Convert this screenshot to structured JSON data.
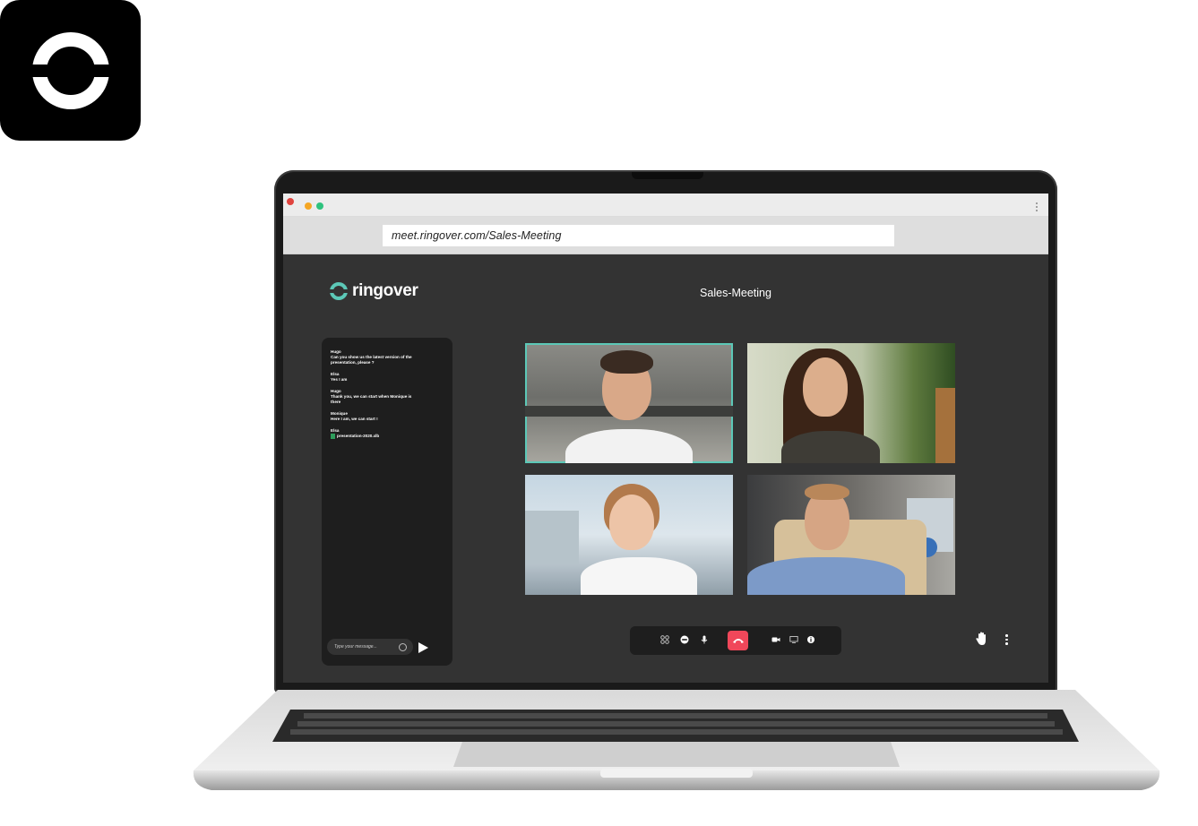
{
  "browser": {
    "url": "meet.ringover.com/Sales-Meeting",
    "window_dots": [
      "#e0443e",
      "#f5a623",
      "#2ec27e"
    ]
  },
  "app": {
    "logo_text": "ringover",
    "brand_color": "#5cc8b7",
    "meeting_title": "Sales-Meeting"
  },
  "chat": {
    "messages": [
      {
        "sender": "Hugo",
        "text": "Can you show us the latest version of the presentation, please ?"
      },
      {
        "sender": "Elsa",
        "text": "Yes I am"
      },
      {
        "sender": "Hugo",
        "text": "Thank you, we can start when Monique is there"
      },
      {
        "sender": "Monique",
        "text": "Here I am, we can start !"
      },
      {
        "sender": "Elsa",
        "text": "presentation-2020.xlb"
      }
    ],
    "input_placeholder": "Type your message..."
  },
  "toolbar": {
    "icons": [
      "grid-icon",
      "minus-circle-icon",
      "microphone-icon",
      "hangup-icon",
      "camera-icon",
      "screen-share-icon",
      "info-icon"
    ],
    "hangup_color": "#f0475a"
  }
}
